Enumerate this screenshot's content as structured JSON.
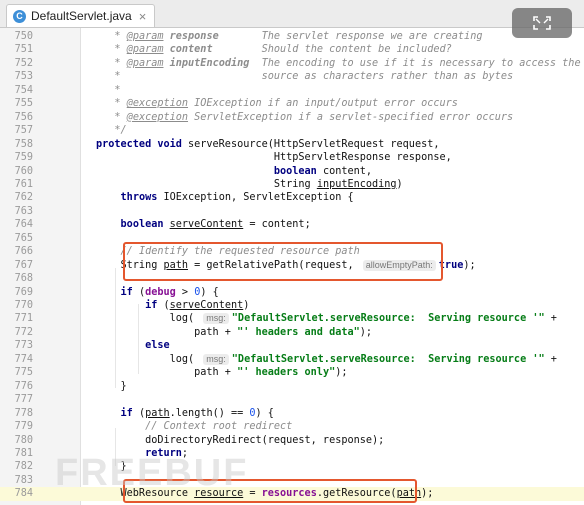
{
  "tab": {
    "icon_letter": "C",
    "filename": "DefaultServlet.java",
    "close": "×"
  },
  "watermark": "FREEBUF",
  "lines": [
    {
      "n": "750",
      "html": "<span class=\"cm\"> * <span class=\"tag\">@param</span> <b>response</b>       The servlet response we are creating</span>"
    },
    {
      "n": "751",
      "html": "<span class=\"cm\"> * <span class=\"tag\">@param</span> <b>content</b>        Should the content be included?</span>"
    },
    {
      "n": "752",
      "html": "<span class=\"cm\"> * <span class=\"tag\">@param</span> <b>inputEncoding</b>  The encoding to use if it is necessary to access the</span>"
    },
    {
      "n": "753",
      "html": "<span class=\"cm\"> *                       source as characters rather than as bytes</span>"
    },
    {
      "n": "754",
      "html": "<span class=\"cm\"> *</span>"
    },
    {
      "n": "755",
      "html": "<span class=\"cm\"> * <span class=\"tag\">@exception</span> IOException if an input/output error occurs</span>"
    },
    {
      "n": "756",
      "html": "<span class=\"cm\"> * <span class=\"tag\">@exception</span> ServletException if a servlet-specified error occurs</span>"
    },
    {
      "n": "757",
      "html": "<span class=\"cm\"> */</span>"
    },
    {
      "n": "758",
      "html": "<span class=\"kw\">protected void</span> serveResource(HttpServletRequest request,"
    },
    {
      "n": "759",
      "html": "                             HttpServletResponse response,"
    },
    {
      "n": "760",
      "html": "                             <span class=\"kw\">boolean</span> content,"
    },
    {
      "n": "761",
      "html": "                             String <span class=\"ul\">inputEncoding</span>)"
    },
    {
      "n": "762",
      "html": "    <span class=\"kw\">throws</span> IOException, ServletException {"
    },
    {
      "n": "763",
      "html": ""
    },
    {
      "n": "764",
      "html": "    <span class=\"kw\">boolean</span> <span class=\"ul\">serveContent</span> = content;"
    },
    {
      "n": "765",
      "html": ""
    },
    {
      "n": "766",
      "html": "    <span class=\"cm\">// Identify the requested resource path</span>"
    },
    {
      "n": "767",
      "html": "    String <span class=\"ul\">path</span> = getRelativePath(request, <span class=\"hint\">allowEmptyPath:</span><span class=\"kw\">true</span>);"
    },
    {
      "n": "768",
      "html": ""
    },
    {
      "n": "769",
      "html": "    <span class=\"kw\">if</span> (<span class=\"field\">debug</span> > <span class=\"num\">0</span>) {"
    },
    {
      "n": "770",
      "html": "        <span class=\"kw\">if</span> (<span class=\"ul\">serveContent</span>)"
    },
    {
      "n": "771",
      "html": "            log( <span class=\"hint\">msg:</span><span class=\"str\">\"DefaultServlet.serveResource:  Serving resource '\"</span> +"
    },
    {
      "n": "772",
      "html": "                path + <span class=\"str\">\"' headers and data\"</span>);"
    },
    {
      "n": "773",
      "html": "        <span class=\"kw\">else</span>"
    },
    {
      "n": "774",
      "html": "            log( <span class=\"hint\">msg:</span><span class=\"str\">\"DefaultServlet.serveResource:  Serving resource '\"</span> +"
    },
    {
      "n": "775",
      "html": "                path + <span class=\"str\">\"' headers only\"</span>);"
    },
    {
      "n": "776",
      "html": "    }"
    },
    {
      "n": "777",
      "html": ""
    },
    {
      "n": "778",
      "html": "    <span class=\"kw\">if</span> (<span class=\"ul\">path</span>.length() == <span class=\"num\">0</span>) {"
    },
    {
      "n": "779",
      "html": "        <span class=\"cm\">// Context root redirect</span>"
    },
    {
      "n": "780",
      "html": "        doDirectoryRedirect(request, response);"
    },
    {
      "n": "781",
      "html": "        <span class=\"kw\">return</span>;"
    },
    {
      "n": "782",
      "html": "    }"
    },
    {
      "n": "783",
      "html": ""
    },
    {
      "n": "784",
      "html": "    WebResource <span class=\"ul\">resource</span> = <span class=\"field\">resources</span>.getResource(<span class=\"ul\">path</span>);"
    }
  ]
}
